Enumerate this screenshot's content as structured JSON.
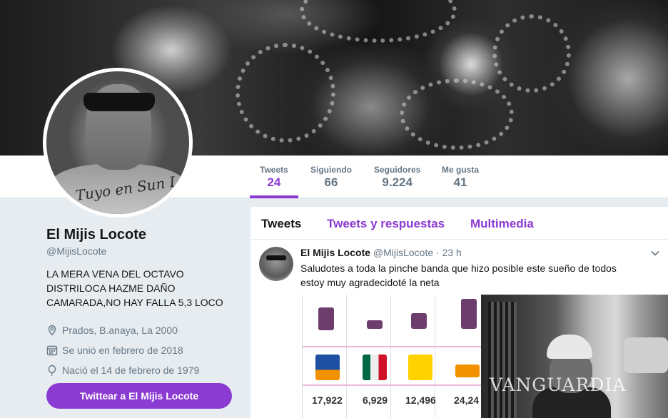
{
  "profile": {
    "name": "El Mijis Locote",
    "handle": "@MijisLocote",
    "bio": "LA MERA VENA DEL OCTAVO DISTRILOCA HAZME DAÑO CAMARADA,NO HAY FALLA 5,3 LOCO",
    "location": "Prados, B.anaya, La 2000",
    "joined": "Se unió en febrero de 2018",
    "birthday": "Nació el 14 de febrero de 1979",
    "tweet_to_button": "Twittear a El Mijis Locote",
    "avatar_tattoo_text": "Tuyo en Sun Luis"
  },
  "stats": [
    {
      "label": "Tweets",
      "value": "24"
    },
    {
      "label": "Siguiendo",
      "value": "66"
    },
    {
      "label": "Seguidores",
      "value": "9.224"
    },
    {
      "label": "Me gusta",
      "value": "41"
    }
  ],
  "timeline": {
    "tabs": [
      "Tweets",
      "Tweets y respuestas",
      "Multimedia"
    ],
    "tweet": {
      "name": "El Mijis Locote",
      "handle": "@MijisLocote",
      "time": "· 23 h",
      "text": "Saludotes a toda la pinche banda que hizo posible este sueño de todos estoy muy agradecidoté la neta",
      "media_numbers": [
        "17,922",
        "6,929",
        "12,496",
        "24,24"
      ]
    }
  },
  "photo": {
    "watermark": "VANGUARDIA"
  },
  "colors": {
    "accent": "#8c3bd2",
    "muted": "#657786",
    "text": "#14171a",
    "page_bg": "#e6ecf0"
  },
  "icons": [
    "location-icon",
    "calendar-icon",
    "balloon-icon",
    "chevron-down-icon"
  ]
}
